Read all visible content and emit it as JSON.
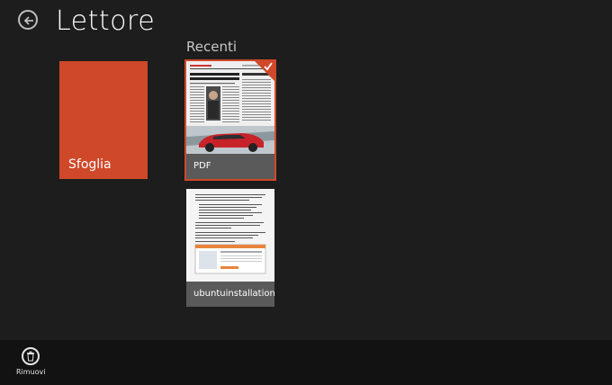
{
  "header": {
    "title": "Lettore",
    "back_icon": "back-arrow-icon"
  },
  "recent": {
    "header": "Recenti",
    "items": [
      {
        "label": "PDF",
        "selected": true,
        "headline": "Stagno a la ofensiva policial y la colaboración internacional",
        "column_title": "Cabeza de puente"
      },
      {
        "label": "ubuntuinstallation",
        "selected": false
      }
    ]
  },
  "browse": {
    "label": "Sfoglia",
    "color": "#d0482a"
  },
  "app_bar": {
    "remove_label": "Rimuovi",
    "remove_icon": "trash-icon"
  },
  "colors": {
    "background": "#1d1d1d",
    "accent": "#d0482a",
    "caption_bg": "#5a5a5a",
    "app_bar_bg": "#121212"
  }
}
